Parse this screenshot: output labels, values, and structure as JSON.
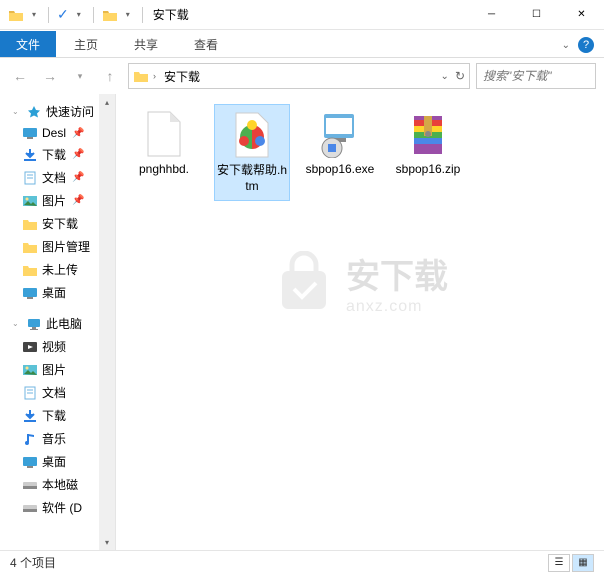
{
  "window": {
    "title": "安下载",
    "minimize": "─",
    "maximize": "☐",
    "close": "✕"
  },
  "ribbon": {
    "file": "文件",
    "home": "主页",
    "share": "共享",
    "view": "查看"
  },
  "nav": {
    "breadcrumb": "安下载",
    "search_placeholder": "搜索\"安下载\""
  },
  "sidebar": {
    "quick_access": "快速访问",
    "items": [
      {
        "label": "Desl",
        "type": "desktop",
        "pinned": true
      },
      {
        "label": "下载",
        "type": "download",
        "pinned": true
      },
      {
        "label": "文档",
        "type": "document",
        "pinned": true
      },
      {
        "label": "图片",
        "type": "picture",
        "pinned": true
      },
      {
        "label": "安下载",
        "type": "folder",
        "pinned": false
      },
      {
        "label": "图片管理",
        "type": "folder",
        "pinned": false
      },
      {
        "label": "未上传",
        "type": "folder",
        "pinned": false
      },
      {
        "label": "桌面",
        "type": "desktop",
        "pinned": false
      }
    ],
    "this_pc": "此电脑",
    "pc_items": [
      {
        "label": "视频",
        "type": "video"
      },
      {
        "label": "图片",
        "type": "picture"
      },
      {
        "label": "文档",
        "type": "document"
      },
      {
        "label": "下载",
        "type": "download"
      },
      {
        "label": "音乐",
        "type": "music"
      },
      {
        "label": "桌面",
        "type": "desktop"
      },
      {
        "label": "本地磁",
        "type": "disk"
      },
      {
        "label": "软件 (D",
        "type": "disk"
      }
    ]
  },
  "files": [
    {
      "name": "pnghhbd.",
      "type": "blank",
      "selected": false
    },
    {
      "name": "安下载帮助.htm",
      "type": "htm",
      "selected": true
    },
    {
      "name": "sbpop16.exe",
      "type": "exe",
      "selected": false
    },
    {
      "name": "sbpop16.zip",
      "type": "zip",
      "selected": false
    }
  ],
  "statusbar": {
    "count": "4 个项目"
  },
  "watermark": {
    "cn": "安下载",
    "en": "anxz.com"
  }
}
